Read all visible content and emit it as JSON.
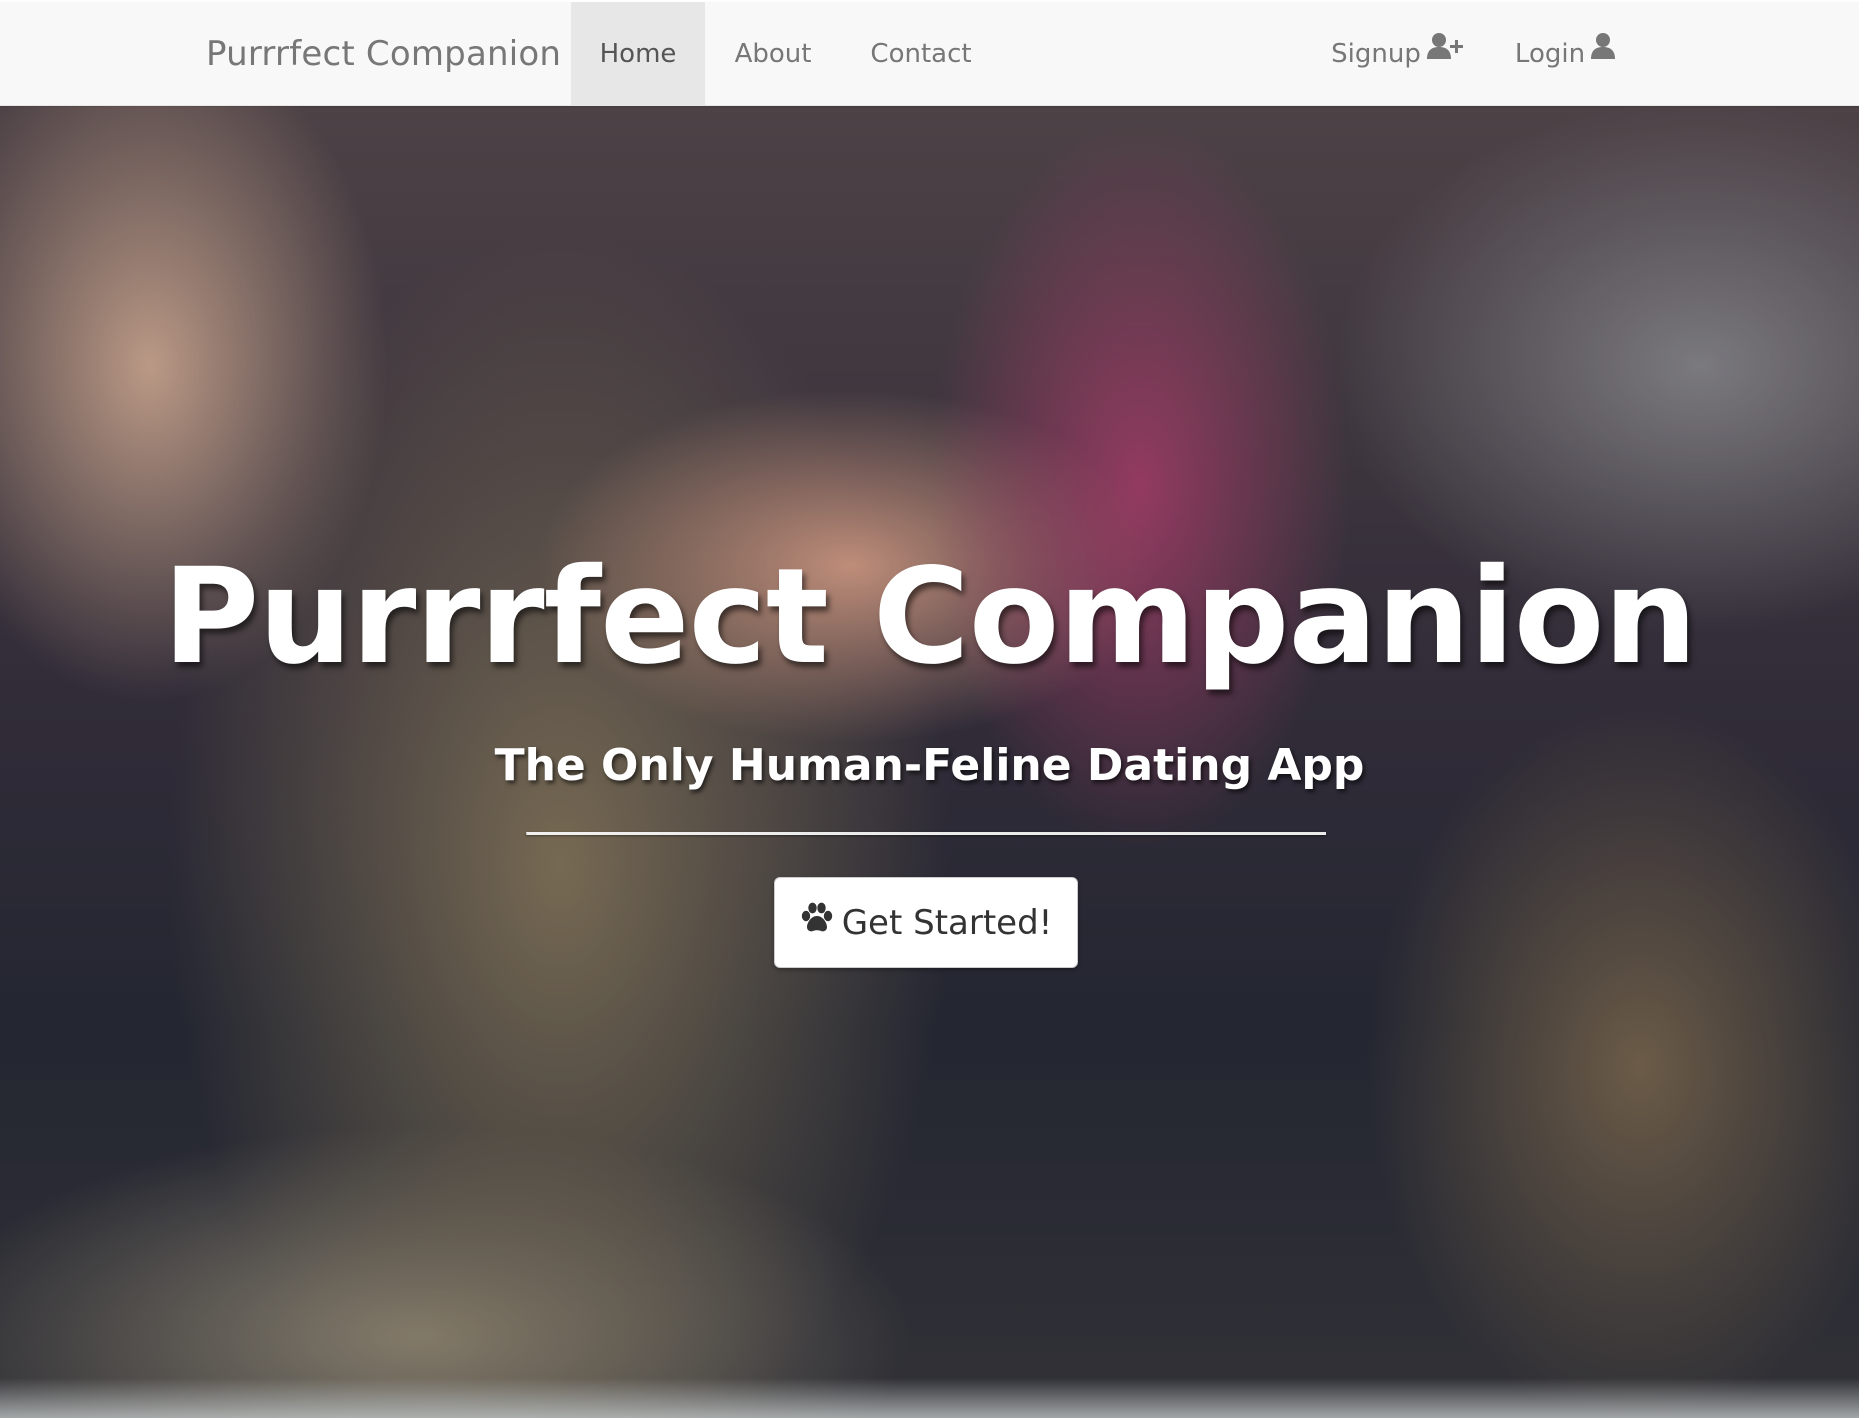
{
  "navbar": {
    "brand": "Purrrfect Companion",
    "items": [
      {
        "label": "Home",
        "active": true
      },
      {
        "label": "About",
        "active": false
      },
      {
        "label": "Contact",
        "active": false
      }
    ],
    "right_items": [
      {
        "label": "Signup",
        "icon": "user-plus-icon"
      },
      {
        "label": "Login",
        "icon": "user-icon"
      }
    ]
  },
  "hero": {
    "title": "Purrrfect Companion",
    "subtitle": "The Only Human-Feline Dating App",
    "cta_label": "Get Started!",
    "cta_icon": "paw-icon"
  },
  "colors": {
    "navbar_bg": "#f8f8f8",
    "nav_text": "#777777",
    "nav_active_bg": "#e7e7e7",
    "hero_text": "#ffffff",
    "button_text": "#333333"
  }
}
